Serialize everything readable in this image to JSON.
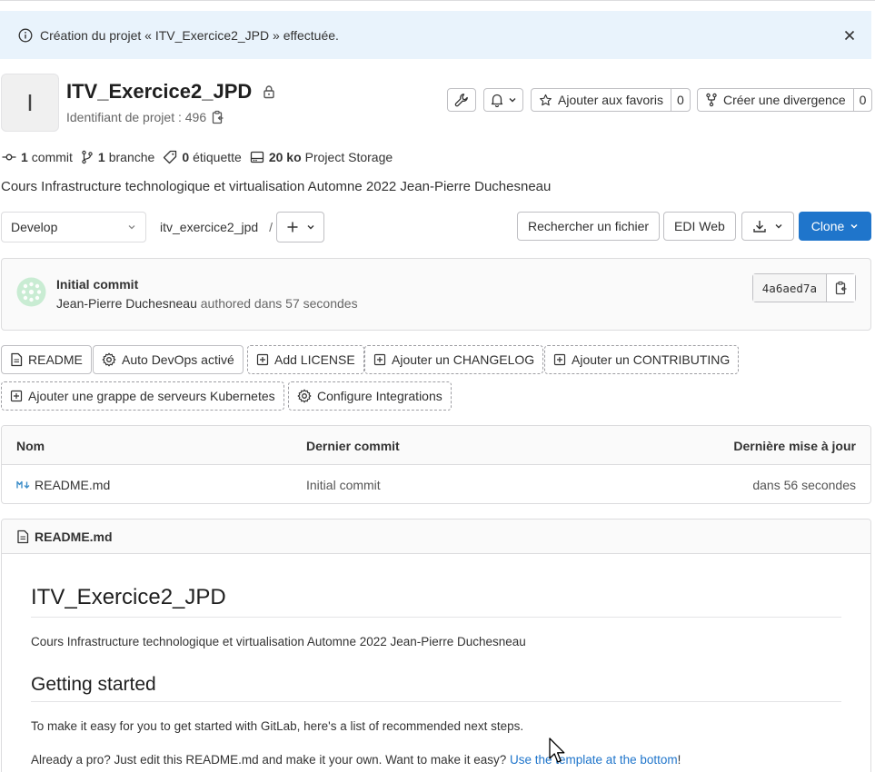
{
  "alert": {
    "message": "Création du projet « ITV_Exercice2_JPD » effectuée."
  },
  "project": {
    "avatar_letter": "I",
    "name": "ITV_Exercice2_JPD",
    "id_label": "Identifiant de projet : 496",
    "description": "Cours Infrastructure technologique et virtualisation Automne 2022 Jean-Pierre Duchesneau"
  },
  "header_actions": {
    "star_label": "Ajouter aux favoris",
    "star_count": "0",
    "fork_label": "Créer une divergence",
    "fork_count": "0"
  },
  "stats": {
    "commits_count": "1",
    "commits_label": "commit",
    "branches_count": "1",
    "branches_label": "branche",
    "tags_count": "0",
    "tags_label": "étiquette",
    "storage_size": "20 ko",
    "storage_label": "Project Storage"
  },
  "repo_bar": {
    "branch": "Develop",
    "path": "itv_exercice2_jpd",
    "path_separator": "/",
    "find_file": "Rechercher un fichier",
    "web_ide": "EDI Web",
    "clone": "Clone"
  },
  "last_commit": {
    "title": "Initial commit",
    "author": "Jean-Pierre Duchesneau",
    "time": "authored dans 57 secondes",
    "sha": "4a6aed7a"
  },
  "quick_actions": {
    "readme": "README",
    "auto_devops": "Auto DevOps activé",
    "add_license": "Add LICENSE",
    "add_changelog": "Ajouter un CHANGELOG",
    "add_contributing": "Ajouter un CONTRIBUTING",
    "add_kubernetes": "Ajouter une grappe de serveurs Kubernetes",
    "configure_integrations": "Configure Integrations"
  },
  "file_table": {
    "headers": {
      "name": "Nom",
      "last_commit": "Dernier commit",
      "last_update": "Dernière mise à jour"
    },
    "rows": [
      {
        "name": "README.md",
        "commit": "Initial commit",
        "updated": "dans 56 secondes"
      }
    ]
  },
  "readme": {
    "filename": "README.md",
    "h1": "ITV_Exercice2_JPD",
    "intro": "Cours Infrastructure technologique et virtualisation Automne 2022 Jean-Pierre Duchesneau",
    "h2": "Getting started",
    "p1": "To make it easy for you to get started with GitLab, here's a list of recommended next steps.",
    "p2_text": "Already a pro? Just edit this README.md and make it your own. Want to make it easy?",
    "p2_link": "Use the template at the bottom",
    "p2_end": "!"
  },
  "colors": {
    "primary": "#1f75cb",
    "alert_bg": "#e9f3fc"
  }
}
